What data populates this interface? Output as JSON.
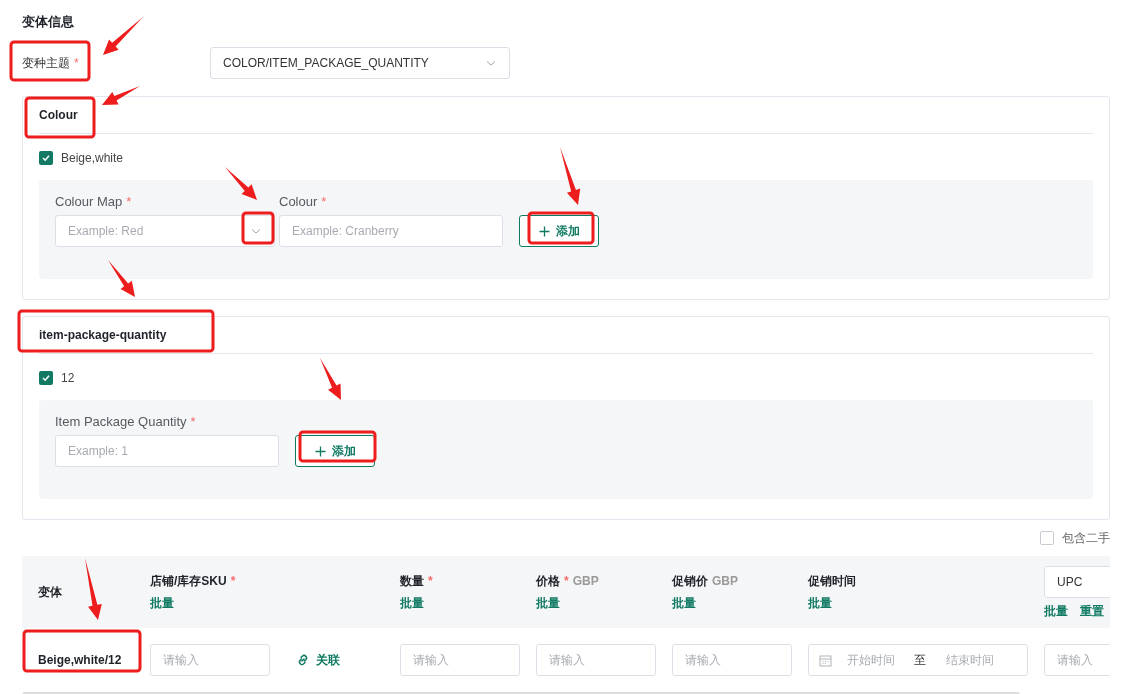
{
  "section_title": "变体信息",
  "theme": {
    "label": "变种主题",
    "required_mark": "*",
    "value": "COLOR/ITEM_PACKAGE_QUANTITY"
  },
  "attributes": [
    {
      "title": "Colour",
      "options": [
        {
          "label": "Beige,white",
          "checked": true
        }
      ],
      "fields": [
        {
          "kind": "select",
          "label": "Colour Map",
          "required_mark": "*",
          "placeholder": "Example: Red"
        },
        {
          "kind": "input",
          "label": "Colour",
          "required_mark": "*",
          "placeholder": "Example: Cranberry"
        }
      ],
      "add_button": "添加"
    },
    {
      "title": "item-package-quantity",
      "options": [
        {
          "label": "12",
          "checked": true
        }
      ],
      "fields": [
        {
          "kind": "input",
          "label": "Item Package Quantity",
          "required_mark": "*",
          "placeholder": "Example: 1"
        }
      ],
      "add_button": "添加"
    }
  ],
  "used_toggle": {
    "label": "包含二手",
    "checked": false
  },
  "table": {
    "columns": [
      {
        "kind": "text",
        "label": "变体"
      },
      {
        "kind": "text",
        "label": "店铺/库存SKU",
        "required_mark": "*",
        "batch": "批量"
      },
      {
        "kind": "text",
        "label": "数量",
        "required_mark": "*",
        "batch": "批量"
      },
      {
        "kind": "text",
        "label": "价格",
        "required_mark": "*",
        "unit": "GBP",
        "batch": "批量"
      },
      {
        "kind": "text",
        "label": "促销价",
        "unit": "GBP",
        "batch": "批量"
      },
      {
        "kind": "text",
        "label": "促销时间",
        "batch": "批量"
      },
      {
        "kind": "select",
        "value": "UPC",
        "actions": [
          "批量",
          "重置"
        ]
      }
    ],
    "rows": [
      [
        {
          "kind": "text",
          "value": "Beige,white/12"
        },
        {
          "kind": "input",
          "placeholder": "请输入",
          "link": "关联"
        },
        {
          "kind": "input",
          "placeholder": "请输入"
        },
        {
          "kind": "input",
          "placeholder": "请输入"
        },
        {
          "kind": "input",
          "placeholder": "请输入"
        },
        {
          "kind": "date_range",
          "start_placeholder": "开始时间",
          "separator": "至",
          "end_placeholder": "结束时间"
        },
        {
          "kind": "input",
          "placeholder": "请输入"
        }
      ]
    ]
  }
}
